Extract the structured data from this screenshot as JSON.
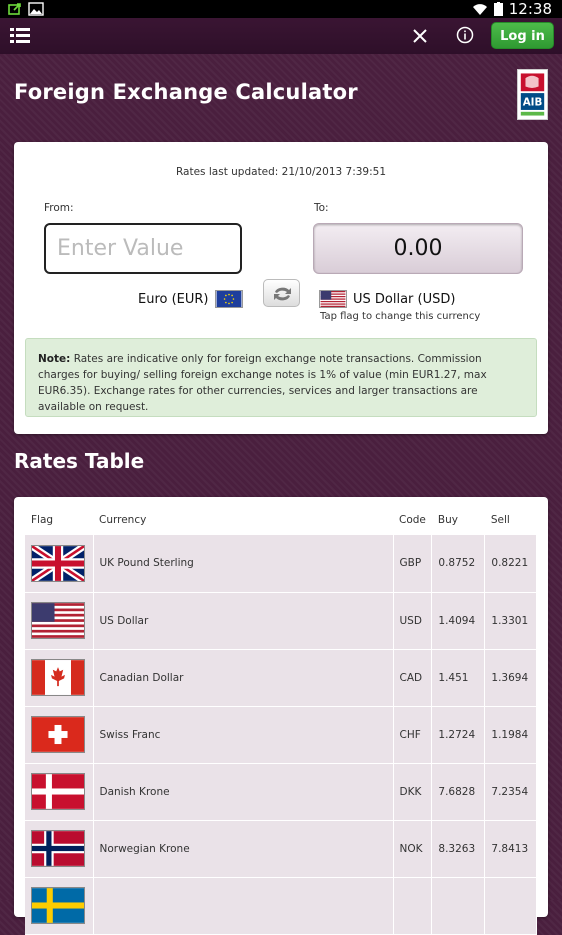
{
  "status": {
    "time": "12:38"
  },
  "appbar": {
    "login_label": "Log in"
  },
  "page": {
    "title": "Foreign Exchange Calculator",
    "logo_text": "AIB"
  },
  "calculator": {
    "rates_updated": "Rates last updated: 21/10/2013 7:39:51",
    "from_label": "From:",
    "to_label": "To:",
    "from_placeholder": "Enter Value",
    "to_value": "0.00",
    "from_currency": "Euro (EUR)",
    "to_currency": "US Dollar (USD)",
    "tap_hint": "Tap flag to change this currency",
    "note_label": "Note:",
    "note_text": "Rates are indicative only for foreign exchange note transactions. Commission charges for buying/ selling foreign exchange notes is 1% of value (min EUR1.27, max EUR6.35). Exchange rates for other currencies, services and larger transactions are available on request."
  },
  "rates": {
    "section_title": "Rates Table",
    "headers": {
      "flag": "Flag",
      "currency": "Currency",
      "code": "Code",
      "buy": "Buy",
      "sell": "Sell"
    },
    "rows": [
      {
        "flag": "uk-flag-icon",
        "currency": "UK Pound Sterling",
        "code": "GBP",
        "buy": "0.8752",
        "sell": "0.8221"
      },
      {
        "flag": "us-flag-icon",
        "currency": "US Dollar",
        "code": "USD",
        "buy": "1.4094",
        "sell": "1.3301"
      },
      {
        "flag": "canada-flag-icon",
        "currency": "Canadian Dollar",
        "code": "CAD",
        "buy": "1.451",
        "sell": "1.3694"
      },
      {
        "flag": "swiss-flag-icon",
        "currency": "Swiss Franc",
        "code": "CHF",
        "buy": "1.2724",
        "sell": "1.1984"
      },
      {
        "flag": "denmark-flag-icon",
        "currency": "Danish Krone",
        "code": "DKK",
        "buy": "7.6828",
        "sell": "7.2354"
      },
      {
        "flag": "norway-flag-icon",
        "currency": "Norwegian Krone",
        "code": "NOK",
        "buy": "8.3263",
        "sell": "7.8413"
      },
      {
        "flag": "sweden-flag-icon",
        "currency": "",
        "code": "",
        "buy": "",
        "sell": ""
      }
    ]
  }
}
